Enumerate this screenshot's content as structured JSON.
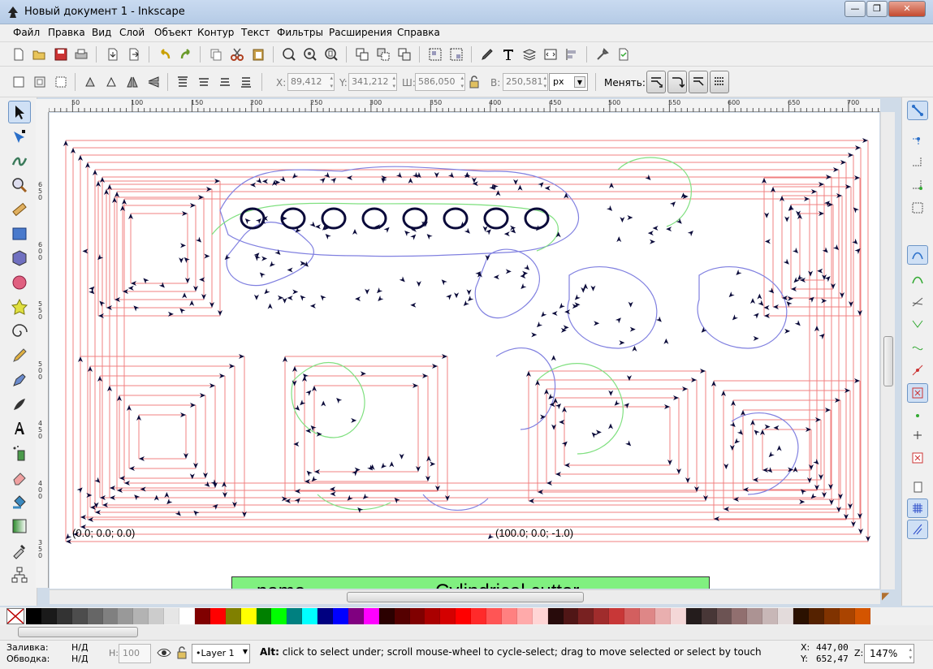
{
  "window": {
    "title": "Новый документ 1 - Inkscape",
    "minimize": "—",
    "maximize": "❐",
    "close": "✕"
  },
  "menu": [
    {
      "label": "Файл"
    },
    {
      "label": "Правка"
    },
    {
      "label": "Вид"
    },
    {
      "label": "Слой"
    },
    {
      "label": "Объект"
    },
    {
      "label": "Контур"
    },
    {
      "label": "Текст"
    },
    {
      "label": "Фильтры"
    },
    {
      "label": "Расширения"
    },
    {
      "label": "Справка"
    }
  ],
  "commands_bar": {
    "icons": [
      "new-icon",
      "open-icon",
      "save-icon",
      "print-icon",
      "import-icon",
      "export-icon",
      "undo-icon",
      "redo-icon",
      "copy-icon",
      "cut-icon",
      "paste-icon",
      "zoom-selection-icon",
      "zoom-drawing-icon",
      "zoom-page-icon",
      "duplicate-icon",
      "clone-icon",
      "unlink-clone-icon",
      "group-icon",
      "ungroup-icon",
      "fill-stroke-icon",
      "text-font-icon",
      "layers-icon",
      "xml-editor-icon",
      "align-icon",
      "preferences-icon",
      "document-properties-icon"
    ]
  },
  "select_bar": {
    "x_label": "X:",
    "x_value": "89,412",
    "y_label": "Y:",
    "y_value": "341,212",
    "w_label": "Ш:",
    "w_value": "586,050",
    "h_label": "В:",
    "h_value": "250,581",
    "unit": "px",
    "change_label": "Менять:"
  },
  "rulers": {
    "top_ticks": [
      "50",
      "100",
      "150",
      "200",
      "250",
      "300",
      "350",
      "400",
      "450",
      "500",
      "550",
      "600",
      "650",
      "700"
    ],
    "left_ticks": [
      "6\n5\n0",
      "6\n0\n0",
      "5\n5\n0",
      "5\n0\n0",
      "4\n5\n0",
      "4\n0\n0",
      "3\n5\n0",
      "3\n0\n0"
    ]
  },
  "canvas": {
    "origin_label": "(0.0; 0.0; 0.0)",
    "end_label": "(100.0; 0.0; -1.0)",
    "info_table": {
      "col1": "name",
      "col2": "Cylindrical cutter",
      "bg": "#80f080"
    },
    "path_colors": {
      "stroke_red": "#f08080",
      "stroke_green": "#80e080",
      "stroke_blue": "#8080e0",
      "arrow": "#0a0a3a"
    }
  },
  "palette": [
    "#000000",
    "#1a1a1a",
    "#333333",
    "#4d4d4d",
    "#666666",
    "#808080",
    "#999999",
    "#b3b3b3",
    "#cccccc",
    "#e6e6e6",
    "#ffffff",
    "#800000",
    "#ff0000",
    "#808000",
    "#ffff00",
    "#008000",
    "#00ff00",
    "#008080",
    "#00ffff",
    "#000080",
    "#0000ff",
    "#800080",
    "#ff00ff",
    "#2b0000",
    "#550000",
    "#800000",
    "#aa0000",
    "#d40000",
    "#ff0000",
    "#ff2a2a",
    "#ff5555",
    "#ff8080",
    "#ffaaaa",
    "#ffd5d5",
    "#280b0b",
    "#501616",
    "#782121",
    "#a02c2c",
    "#c83737",
    "#d35f5f",
    "#de8787",
    "#e9afaf",
    "#f4d7d7",
    "#241c1c",
    "#483737",
    "#6c5353",
    "#916f6f",
    "#ac9393",
    "#c8b7b7",
    "#e3dbdb",
    "#2b1100",
    "#552200",
    "#803300",
    "#aa4400",
    "#d45500"
  ],
  "status": {
    "fill_label": "Заливка:",
    "fill_value": "Н/Д",
    "stroke_label": "Обводка:",
    "stroke_value": "Н/Д",
    "opacity_label": "Н:",
    "opacity_value": "100",
    "layer": "•Layer 1",
    "message_bold": "Alt:",
    "message": "click to select under; scroll mouse-wheel to cycle-select; drag to move selected or select by touch",
    "cursor_x_label": "X:",
    "cursor_x": "447,00",
    "cursor_y_label": "Y:",
    "cursor_y": "652,47",
    "zoom_label": "Z:",
    "zoom": "147%"
  }
}
